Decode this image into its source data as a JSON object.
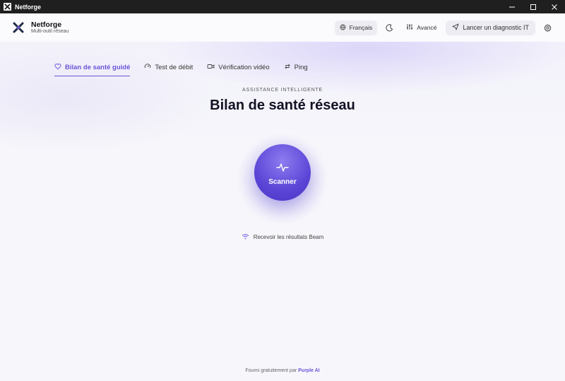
{
  "window": {
    "title": "Netforge"
  },
  "brand": {
    "name": "Netforge",
    "subtitle": "Multi-outil réseau"
  },
  "header": {
    "language_label": "Français",
    "advanced_label": "Avancé",
    "diagnostic_label": "Lancer un diagnostic IT"
  },
  "tabs": [
    {
      "label": "Bilan de santé guidé",
      "icon": "heart-icon",
      "active": true
    },
    {
      "label": "Test de débit",
      "icon": "gauge-icon",
      "active": false
    },
    {
      "label": "Vérification vidéo",
      "icon": "video-icon",
      "active": false
    },
    {
      "label": "Ping",
      "icon": "ping-icon",
      "active": false
    }
  ],
  "hero": {
    "eyebrow": "ASSISTANCE INTELLIGENTE",
    "title": "Bilan de santé réseau",
    "scan_label": "Scanner"
  },
  "beam": {
    "label": "Recevoir les résultats Beam"
  },
  "footer": {
    "prefix": "Fourni gratuitement par",
    "brand": "Purple AI"
  },
  "colors": {
    "accent": "#6a55d8",
    "titlebar": "#1f1f1f",
    "background": "#f7f7fb"
  }
}
